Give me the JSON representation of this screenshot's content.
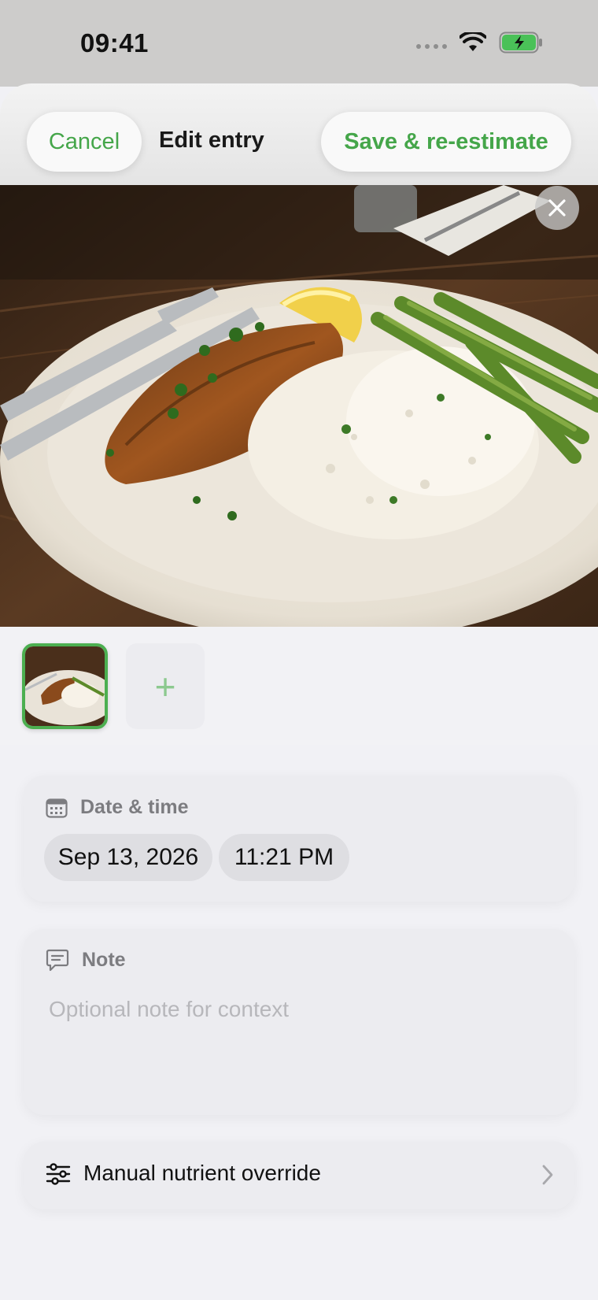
{
  "status_bar": {
    "time": "09:41",
    "icons": [
      "cellular-dots-icon",
      "wifi-icon",
      "battery-charging-icon"
    ]
  },
  "header": {
    "cancel_label": "Cancel",
    "title": "Edit entry",
    "save_label": "Save & re-estimate"
  },
  "photo": {
    "description_icon": "meal-photo",
    "close_icon": "close-icon"
  },
  "thumbnails": {
    "add_label": "+"
  },
  "date_time": {
    "label": "Date & time",
    "icon": "calendar-icon",
    "date": "Sep 13, 2026",
    "time": "11:21 PM"
  },
  "note": {
    "label": "Note",
    "icon": "note-icon",
    "value": "",
    "placeholder": "Optional note for context"
  },
  "override": {
    "label": "Manual nutrient override",
    "icon": "sliders-icon"
  },
  "colors": {
    "accent": "#45a64a",
    "background": "#f1f1f5",
    "card": "#ececf0"
  }
}
